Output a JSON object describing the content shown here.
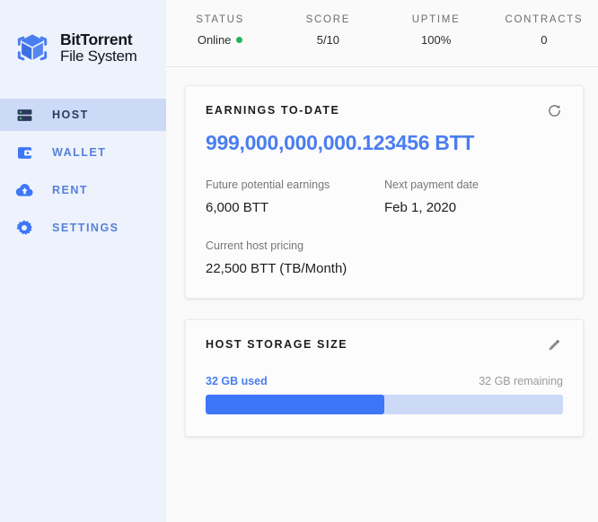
{
  "brand": {
    "logo_icon": "bittorrent-cube-logo",
    "line1": "BitTorrent",
    "line2": "File System"
  },
  "sidebar": {
    "items": [
      {
        "label": "HOST",
        "icon": "server-icon",
        "active": true
      },
      {
        "label": "WALLET",
        "icon": "wallet-icon",
        "active": false
      },
      {
        "label": "RENT",
        "icon": "cloud-upload-icon",
        "active": false
      },
      {
        "label": "SETTINGS",
        "icon": "gear-icon",
        "active": false
      }
    ]
  },
  "statsbar": {
    "stats": [
      {
        "label": "STATUS",
        "value": "Online",
        "dot": true,
        "dot_color": "#21b563"
      },
      {
        "label": "SCORE",
        "value": "5/10",
        "dot": false
      },
      {
        "label": "UPTIME",
        "value": "100%",
        "dot": false
      },
      {
        "label": "CONTRACTS",
        "value": "0",
        "dot": false
      }
    ]
  },
  "earnings_card": {
    "title": "EARNINGS TO-DATE",
    "refresh_icon": "refresh-icon",
    "amount": "999,000,000,000.123456 BTT",
    "amount_color": "#4a7df0",
    "future_label": "Future potential earnings",
    "future_value": "6,000 BTT",
    "next_payment_label": "Next payment date",
    "next_payment_value": "Feb 1, 2020",
    "pricing_label": "Current host pricing",
    "pricing_value": "22,500 BTT (TB/Month)"
  },
  "storage_card": {
    "title": "HOST STORAGE SIZE",
    "edit_icon": "pencil-edit-icon",
    "used_label": "32 GB used",
    "remaining_label": "32 GB remaining",
    "used_percent": 50,
    "fill_color": "#3d77f7",
    "track_color": "#ccdaf8"
  }
}
